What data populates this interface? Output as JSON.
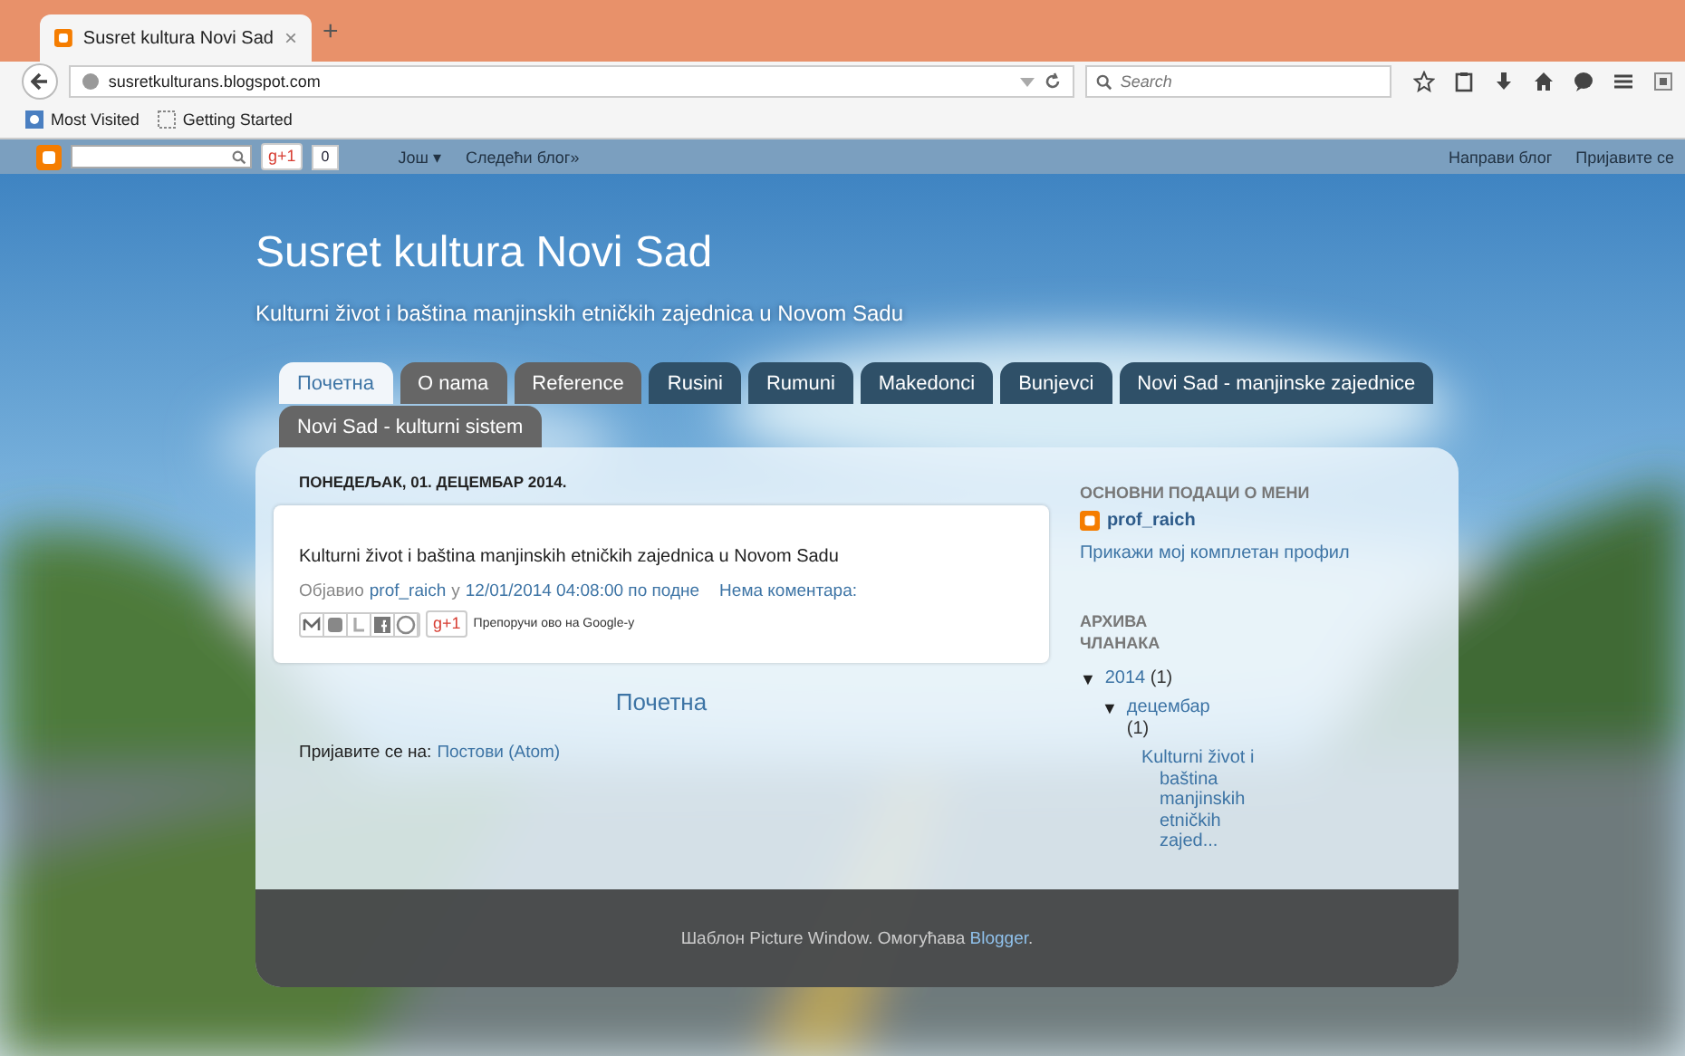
{
  "browser": {
    "tab": {
      "title": "Susret kultura Novi Sad",
      "close": "×"
    },
    "new_tab": "+",
    "url": "susretkulturans.blogspot.com",
    "search": {
      "placeholder": "Search"
    },
    "bookmarks": [
      "Most Visited",
      "Getting Started"
    ]
  },
  "navbar": {
    "plus_one": "g+1",
    "count": "0",
    "more": "Још ▾",
    "next_blog": "Следећи блог»",
    "create_blog": "Направи блог",
    "sign_in": "Пријавите се"
  },
  "blog": {
    "title": "Susret kultura Novi Sad",
    "description": "Kulturni život i baština manjinskih etničkih zajednica u Novom Sadu",
    "tabs": [
      {
        "label": "Почетна",
        "selected": true,
        "color": "#f2f6fa"
      },
      {
        "label": "O nama",
        "selected": false,
        "color": "#666666"
      },
      {
        "label": "Reference",
        "selected": false,
        "color": "#636363"
      },
      {
        "label": "Rusini",
        "selected": false,
        "color": "#2f5068"
      },
      {
        "label": "Rumuni",
        "selected": false,
        "color": "#2f5068"
      },
      {
        "label": "Makedonci",
        "selected": false,
        "color": "#2f5068"
      },
      {
        "label": "Bunjevci",
        "selected": false,
        "color": "#2f5068"
      },
      {
        "label": "Novi Sad - manjinske zajednice",
        "selected": false,
        "color": "#2f5068"
      },
      {
        "label": "Novi Sad - kulturni sistem",
        "selected": false,
        "color": "#666666"
      }
    ],
    "post": {
      "date_header": "ПОНЕДЕЉАК, 01. ДЕЦЕМБАР 2014.",
      "body": "Kulturni život i baština manjinskih etničkih zajednica u Novom Sadu",
      "posted_by": "Објавио",
      "author": "prof_raich",
      "at": "у",
      "timestamp": "12/01/2014 04:08:00 по подне",
      "comments": "Нема коментара:",
      "plus_one": "g+1",
      "recommend": "Препоручи ово на Google-у"
    },
    "home_link": "Почетна",
    "feed_label": "Пријавите се на:",
    "feed_link": "Постови (Atom)",
    "sidebar": {
      "profile_heading": "ОСНОВНИ ПОДАЦИ О МЕНИ",
      "profile_name": "prof_raich",
      "profile_link": "Прикажи мој комплетан профил",
      "archive_heading": "АРХИВА ЧЛАНАКА",
      "archive": [
        {
          "toggle": "▼",
          "label": "2014",
          "count": "(1)",
          "expanded": true,
          "children": [
            {
              "toggle": "▼",
              "label": "децембар",
              "count": "(1)",
              "expanded": true,
              "children": [
                {
                  "label": "Kulturni život i baština manjinskih etničkih zajed..."
                }
              ]
            }
          ]
        }
      ]
    },
    "footer": {
      "text": "Шаблон Picture Window. Омогућава ",
      "link": "Blogger",
      "end": "."
    }
  }
}
